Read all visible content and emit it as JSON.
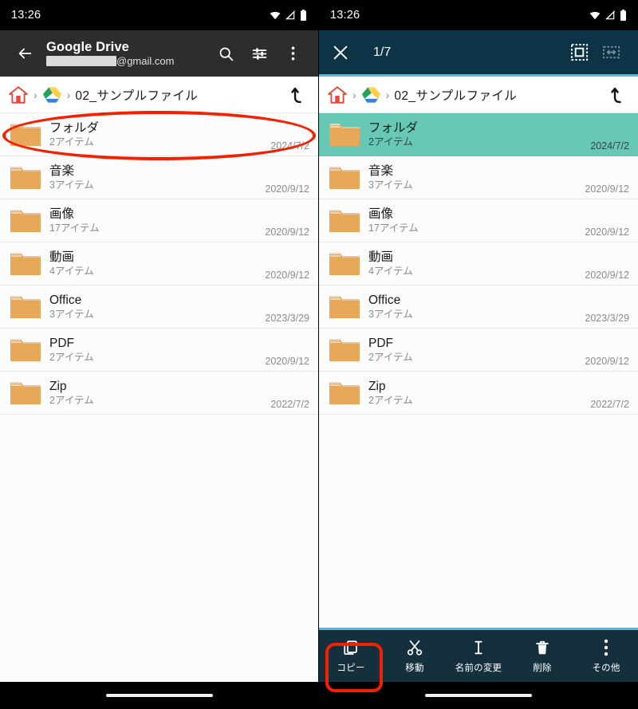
{
  "left": {
    "statusbar": {
      "time": "13:26",
      "icons": [
        "wifi-icon",
        "signal-off-icon",
        "battery-icon"
      ]
    },
    "appbar": {
      "back_icon": "arrow-back-icon",
      "title": "Google Drive",
      "account_suffix": "@gmail.com",
      "account_redacted": true,
      "actions": [
        {
          "name": "search-icon",
          "label": "Search"
        },
        {
          "name": "tune-icon",
          "label": "Filter"
        },
        {
          "name": "overflow-menu-icon",
          "label": "More options"
        }
      ]
    },
    "breadcrumb": {
      "home_icon": "home-icon",
      "drive_icon": "google-drive-icon",
      "separator": "›",
      "current": "02_サンプルファイル",
      "up_icon": "go-up-icon"
    },
    "files": [
      {
        "name": "フォルダ",
        "meta": "2アイテム",
        "date": "2024/7/2",
        "selected": false
      },
      {
        "name": "音楽",
        "meta": "3アイテム",
        "date": "2020/9/12",
        "selected": false
      },
      {
        "name": "画像",
        "meta": "17アイテム",
        "date": "2020/9/12",
        "selected": false
      },
      {
        "name": "動画",
        "meta": "4アイテム",
        "date": "2020/9/12",
        "selected": false
      },
      {
        "name": "Office",
        "meta": "3アイテム",
        "date": "2023/3/29",
        "selected": false
      },
      {
        "name": "PDF",
        "meta": "2アイテム",
        "date": "2020/9/12",
        "selected": false
      },
      {
        "name": "Zip",
        "meta": "2アイテム",
        "date": "2022/7/2",
        "selected": false
      }
    ]
  },
  "right": {
    "statusbar": {
      "time": "13:26",
      "icons": [
        "wifi-icon",
        "signal-off-icon",
        "battery-icon"
      ]
    },
    "selectionbar": {
      "close_icon": "close-icon",
      "count": "1/7",
      "actions": [
        {
          "name": "select-all-icon",
          "label": "Select all",
          "dimmed": false
        },
        {
          "name": "select-range-icon",
          "label": "Select range",
          "dimmed": true
        }
      ]
    },
    "breadcrumb": {
      "home_icon": "home-icon",
      "drive_icon": "google-drive-icon",
      "separator": "›",
      "current": "02_サンプルファイル",
      "up_icon": "go-up-icon"
    },
    "files": [
      {
        "name": "フォルダ",
        "meta": "2アイテム",
        "date": "2024/7/2",
        "selected": true
      },
      {
        "name": "音楽",
        "meta": "3アイテム",
        "date": "2020/9/12",
        "selected": false
      },
      {
        "name": "画像",
        "meta": "17アイテム",
        "date": "2020/9/12",
        "selected": false
      },
      {
        "name": "動画",
        "meta": "4アイテム",
        "date": "2020/9/12",
        "selected": false
      },
      {
        "name": "Office",
        "meta": "3アイテム",
        "date": "2023/3/29",
        "selected": false
      },
      {
        "name": "PDF",
        "meta": "2アイテム",
        "date": "2020/9/12",
        "selected": false
      },
      {
        "name": "Zip",
        "meta": "2アイテム",
        "date": "2022/7/2",
        "selected": false
      }
    ],
    "actionbar": [
      {
        "name": "copy-action",
        "icon": "copy-icon",
        "label": "コピー",
        "highlighted": true
      },
      {
        "name": "move-action",
        "icon": "scissors-icon",
        "label": "移動",
        "highlighted": false
      },
      {
        "name": "rename-action",
        "icon": "text-cursor-icon",
        "label": "名前の変更",
        "highlighted": false
      },
      {
        "name": "delete-action",
        "icon": "trash-icon",
        "label": "削除",
        "highlighted": false
      },
      {
        "name": "more-action",
        "icon": "overflow-menu-icon",
        "label": "その他",
        "highlighted": false
      }
    ]
  },
  "annotations": {
    "colors": {
      "highlight": "#f42000",
      "selection_row": "#68c8b6",
      "accent_line": "#4fbde0",
      "toolbar_dark": "#0d3446"
    },
    "items": [
      {
        "name": "highlight-first-row-ellipse",
        "shape": "ellipse"
      },
      {
        "name": "highlight-copy-button-rect",
        "shape": "rounded-rect"
      }
    ]
  }
}
